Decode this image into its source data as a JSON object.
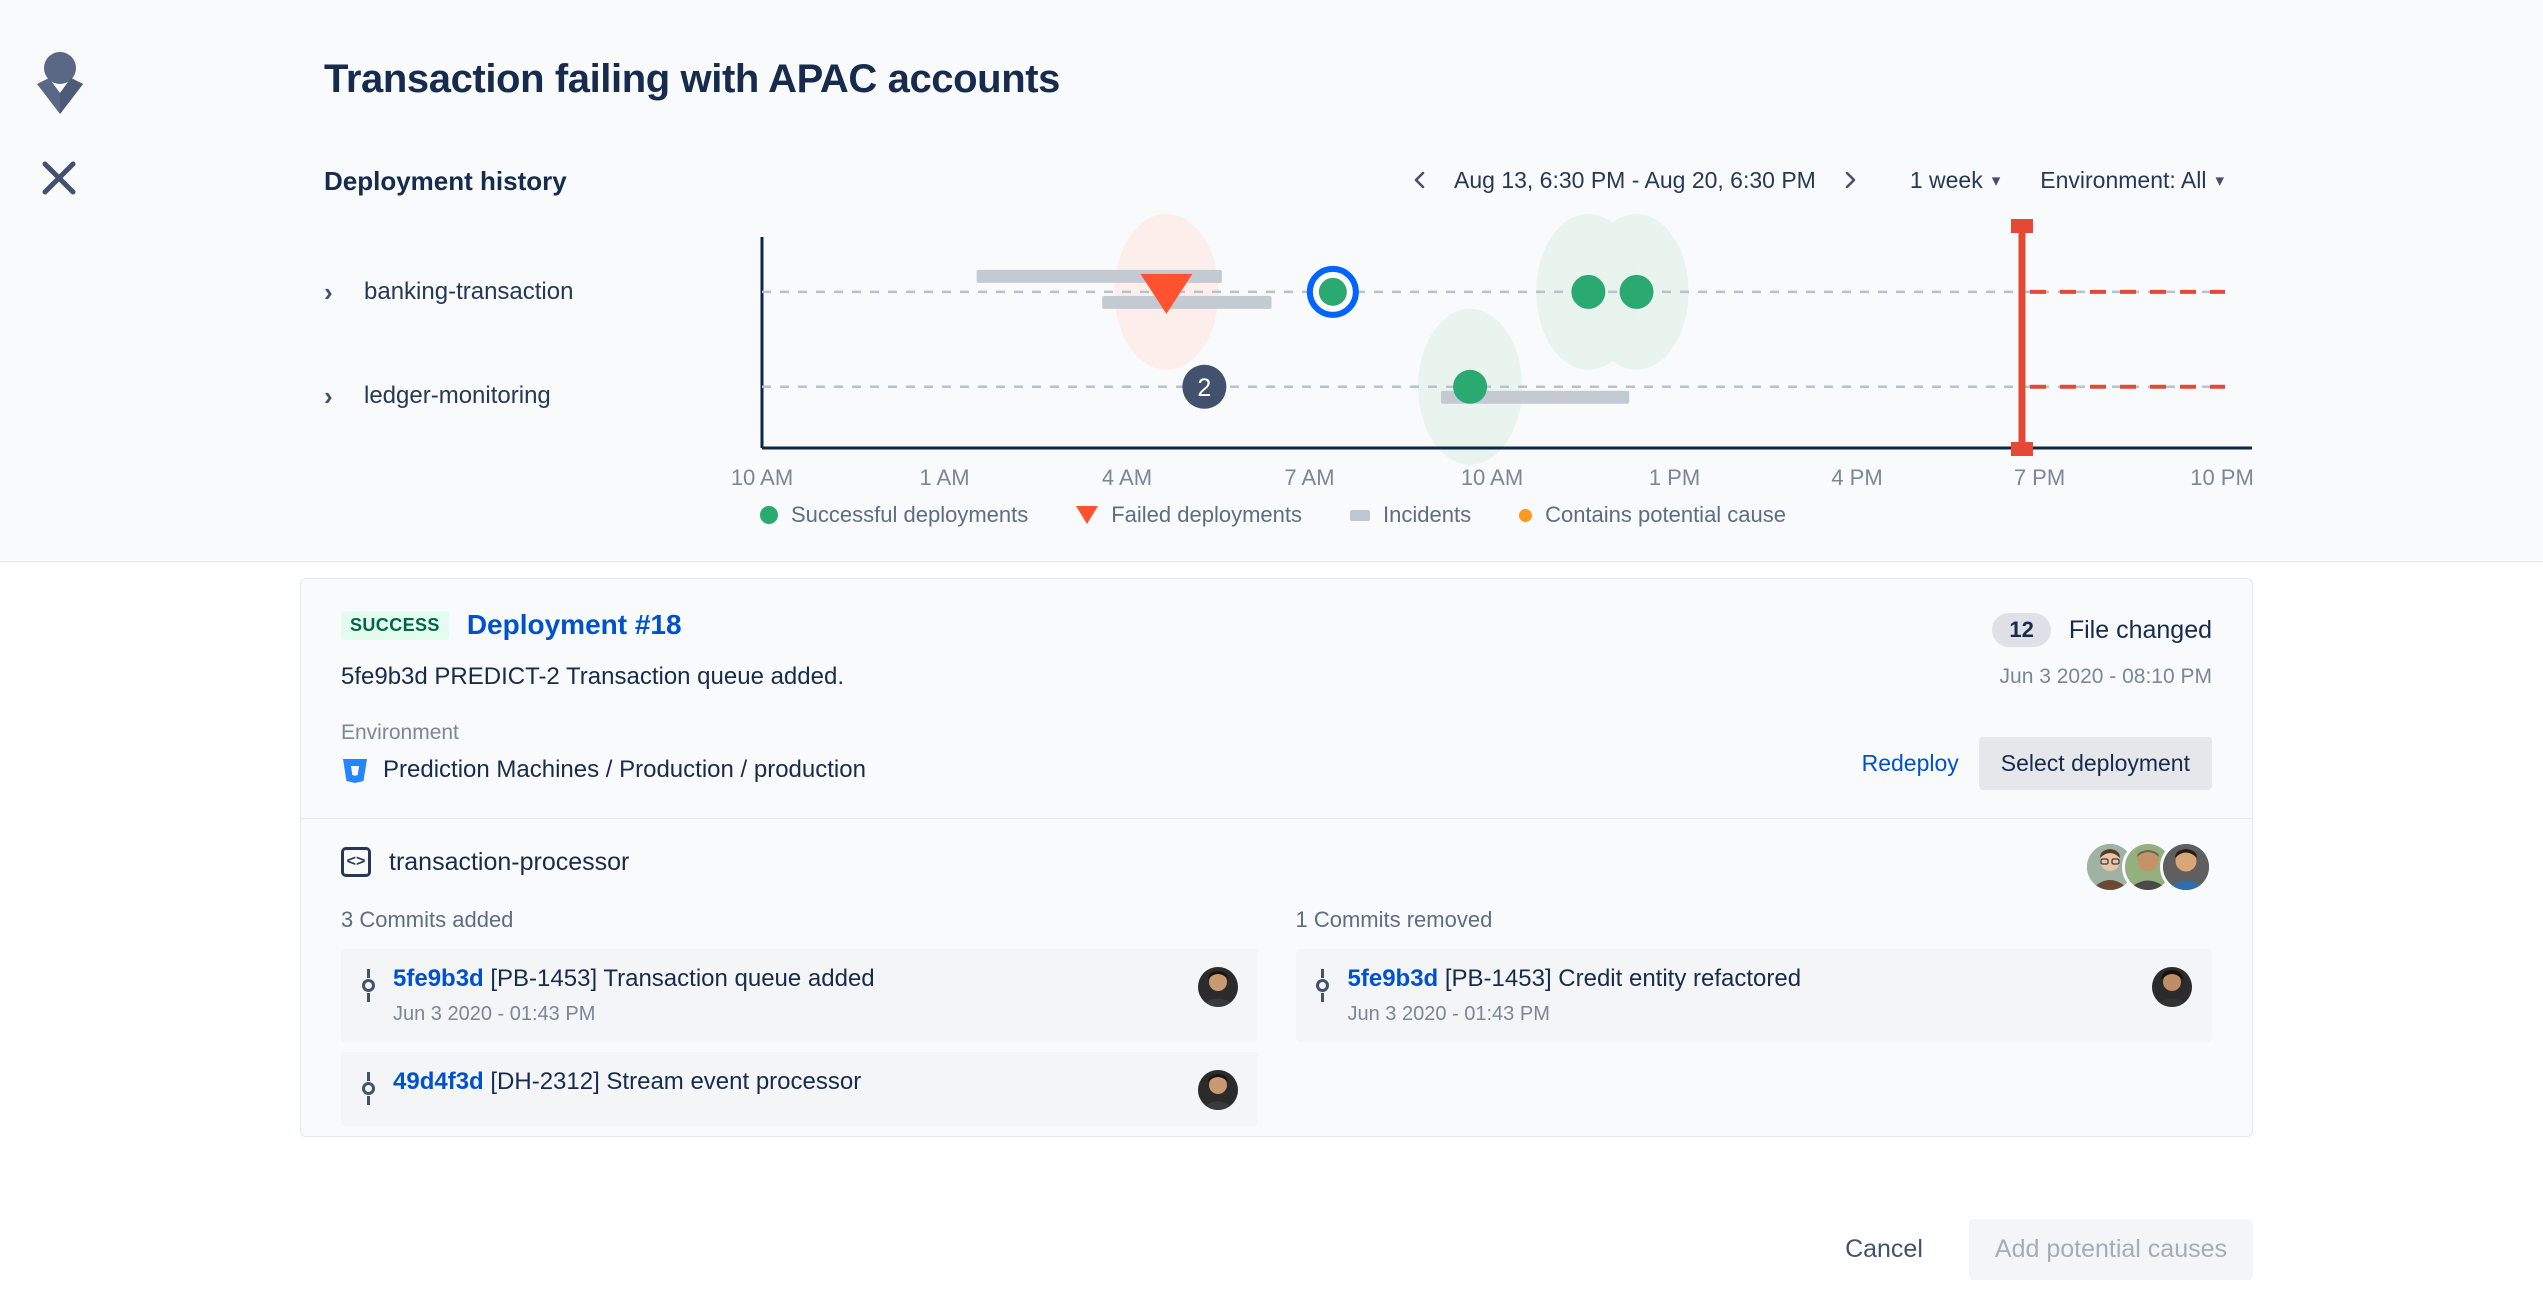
{
  "header": {
    "title": "Transaction failing with APAC accounts",
    "section_title": "Deployment history",
    "avatar_icon": "person-icon",
    "close_icon": "close-icon"
  },
  "timeline_controls": {
    "prev_icon": "chevron-left-icon",
    "next_icon": "chevron-right-icon",
    "date_range": "Aug 13, 6:30 PM - Aug 20, 6:30 PM",
    "period": "1 week",
    "environment": "Environment: All",
    "caret_icon": "chevron-down-icon"
  },
  "rows": [
    {
      "label": "banking-transaction",
      "expand_icon": "chevron-right-icon"
    },
    {
      "label": "ledger-monitoring",
      "expand_icon": "chevron-right-icon"
    }
  ],
  "legend": [
    {
      "label": "Successful deployments",
      "marker": "green-circle",
      "color": "#2aa971"
    },
    {
      "label": "Failed deployments",
      "marker": "red-triangle",
      "color": "#ff5230"
    },
    {
      "label": "Incidents",
      "marker": "grey-bar",
      "color": "#c1c7d0"
    },
    {
      "label": "Contains potential cause",
      "marker": "orange-dot",
      "color": "#ff991f"
    }
  ],
  "chart_data": {
    "type": "scatter",
    "title": "Deployment history",
    "xlabel": "",
    "ylabel": "",
    "grid": true,
    "legend_position": "bottom",
    "x_ticks": [
      "10 AM",
      "1 AM",
      "4 AM",
      "7 AM",
      "10 AM",
      "1 PM",
      "4 PM",
      "7 PM",
      "10 PM"
    ],
    "x_tick_positions": [
      0,
      12.5,
      25,
      37.5,
      50,
      62.5,
      75,
      87.5,
      100
    ],
    "lanes": [
      {
        "name": "banking-transaction",
        "y_pct": 26
      },
      {
        "name": "ledger-monitoring",
        "y_pct": 71
      }
    ],
    "series": [
      {
        "name": "Successful deployments",
        "type": "circle",
        "color": "#2aa971",
        "points": [
          {
            "lane": "banking-transaction",
            "x_pct": 39.1,
            "selected": true,
            "halo": false
          },
          {
            "lane": "banking-transaction",
            "x_pct": 56.6,
            "selected": false,
            "halo": true
          },
          {
            "lane": "banking-transaction",
            "x_pct": 59.9,
            "selected": false,
            "halo": true
          },
          {
            "lane": "ledger-monitoring",
            "x_pct": 48.5,
            "selected": false,
            "halo": true
          }
        ]
      },
      {
        "name": "Failed deployments",
        "type": "triangle",
        "color": "#ff5230",
        "points": [
          {
            "lane": "banking-transaction",
            "x_pct": 27.7,
            "halo": true
          }
        ]
      },
      {
        "name": "Incidents",
        "type": "bar",
        "color": "#c1c7d0",
        "bars": [
          {
            "lane": "banking-transaction",
            "offset_y": -16,
            "x_start_pct": 14.7,
            "x_end_pct": 31.5
          },
          {
            "lane": "banking-transaction",
            "offset_y": 10,
            "x_start_pct": 23.3,
            "x_end_pct": 34.9
          },
          {
            "lane": "ledger-monitoring",
            "offset_y": 10,
            "x_start_pct": 46.5,
            "x_end_pct": 59.4
          }
        ]
      }
    ],
    "annotations": [
      {
        "type": "cluster-badge",
        "label": "2",
        "lane": "ledger-monitoring",
        "x_pct": 30.3,
        "color": "#42526e"
      },
      {
        "type": "marker-line",
        "label": "",
        "x_pct": 86.3,
        "color": "#e34935"
      }
    ]
  },
  "deployment": {
    "status": "Success",
    "title": "Deployment #18",
    "description": "5fe9b3d  PREDICT-2 Transaction queue added.",
    "environment_label": "Environment",
    "environment_value": "Prediction Machines / Production / production",
    "environment_icon": "bitbucket-icon",
    "files_changed_count": "12",
    "files_changed_label": "File changed",
    "date": "Jun 3 2020 - 08:10 PM",
    "redeploy_label": "Redeploy",
    "select_label": "Select deployment"
  },
  "repo": {
    "name": "transaction-processor",
    "icon": "code-icon",
    "avatars": [
      "avatar-1",
      "avatar-2",
      "avatar-3"
    ]
  },
  "commits_added": {
    "title": "3 Commits added",
    "items": [
      {
        "sha": "5fe9b3d",
        "message": "[PB-1453] Transaction queue added",
        "date": "Jun 3 2020 - 01:43 PM"
      },
      {
        "sha": "49d4f3d",
        "message": "[DH-2312] Stream event processor",
        "date": ""
      }
    ]
  },
  "commits_removed": {
    "title": "1 Commits removed",
    "items": [
      {
        "sha": "5fe9b3d",
        "message": "[PB-1453] Credit entity refactored",
        "date": "Jun 3 2020 - 01:43 PM"
      }
    ]
  },
  "footer": {
    "cancel_label": "Cancel",
    "add_label": "Add potential causes"
  }
}
